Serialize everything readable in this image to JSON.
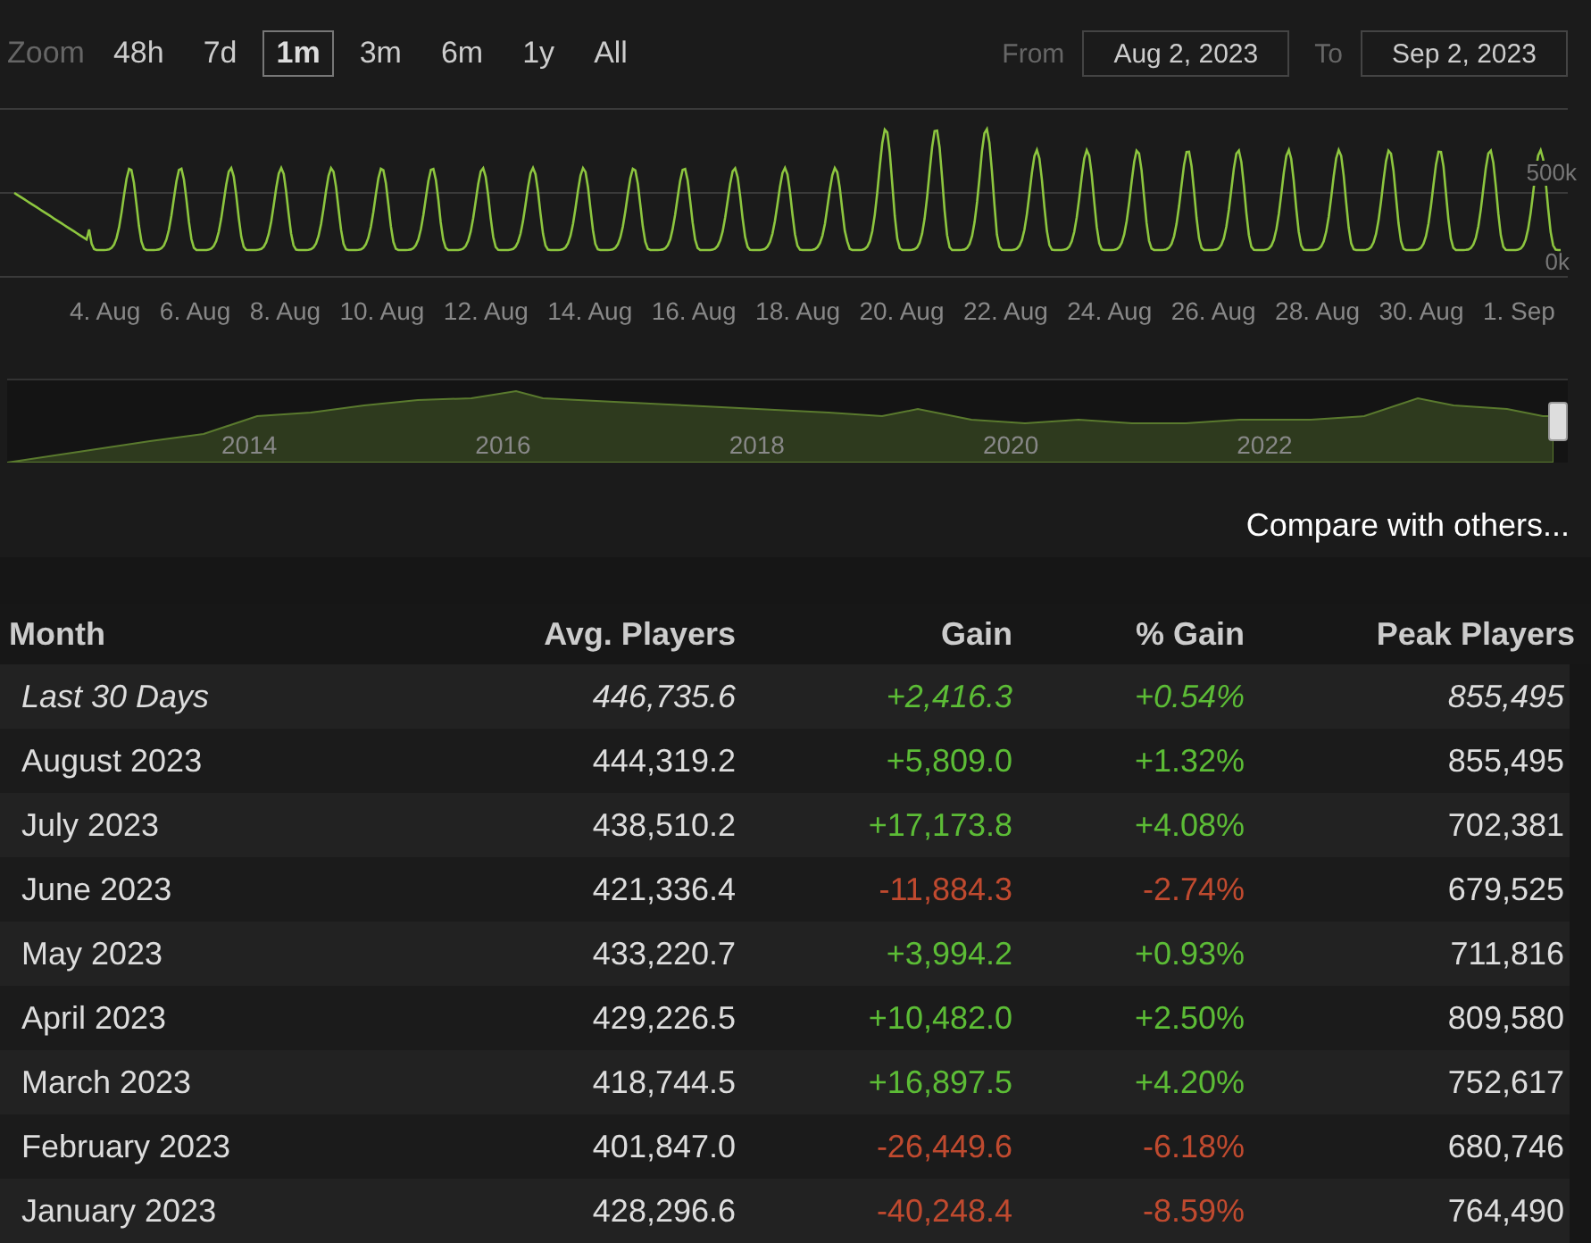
{
  "zoom": {
    "label": "Zoom",
    "options": [
      {
        "label": "48h",
        "selected": false
      },
      {
        "label": "7d",
        "selected": false
      },
      {
        "label": "1m",
        "selected": true
      },
      {
        "label": "3m",
        "selected": false
      },
      {
        "label": "6m",
        "selected": false
      },
      {
        "label": "1y",
        "selected": false
      },
      {
        "label": "All",
        "selected": false
      }
    ]
  },
  "range": {
    "from_label": "From",
    "from": "Aug 2, 2023",
    "to_label": "To",
    "to": "Sep 2, 2023"
  },
  "chart": {
    "y_labels": [
      "500k",
      "0k"
    ],
    "x_labels": [
      "4. Aug",
      "6. Aug",
      "8. Aug",
      "10. Aug",
      "12. Aug",
      "14. Aug",
      "16. Aug",
      "18. Aug",
      "20. Aug",
      "22. Aug",
      "24. Aug",
      "26. Aug",
      "28. Aug",
      "30. Aug",
      "1. Sep"
    ]
  },
  "navigator": {
    "x_labels": [
      "2014",
      "2016",
      "2018",
      "2020",
      "2022"
    ]
  },
  "compare_link": "Compare with others...",
  "table": {
    "columns": [
      "Month",
      "Avg. Players",
      "Gain",
      "% Gain",
      "Peak Players"
    ],
    "rows": [
      {
        "kind": "summary",
        "color": "#5cbc36",
        "month": "Last 30 Days",
        "avg": "446,735.6",
        "gain": "+2,416.3",
        "pct": "+0.54%",
        "peak": "855,495"
      },
      {
        "kind": "month",
        "color": "#5cbc36",
        "month": "August 2023",
        "avg": "444,319.2",
        "gain": "+5,809.0",
        "pct": "+1.32%",
        "peak": "855,495"
      },
      {
        "kind": "month",
        "color": "#5cbc36",
        "month": "July 2023",
        "avg": "438,510.2",
        "gain": "+17,173.8",
        "pct": "+4.08%",
        "peak": "702,381"
      },
      {
        "kind": "month",
        "color": "#c04a2f",
        "month": "June 2023",
        "avg": "421,336.4",
        "gain": "-11,884.3",
        "pct": "-2.74%",
        "peak": "679,525"
      },
      {
        "kind": "month",
        "color": "#5cbc36",
        "month": "May 2023",
        "avg": "433,220.7",
        "gain": "+3,994.2",
        "pct": "+0.93%",
        "peak": "711,816"
      },
      {
        "kind": "month",
        "color": "#5cbc36",
        "month": "April 2023",
        "avg": "429,226.5",
        "gain": "+10,482.0",
        "pct": "+2.50%",
        "peak": "809,580"
      },
      {
        "kind": "month",
        "color": "#5cbc36",
        "month": "March 2023",
        "avg": "418,744.5",
        "gain": "+16,897.5",
        "pct": "+4.20%",
        "peak": "752,617"
      },
      {
        "kind": "month",
        "color": "#c04a2f",
        "month": "February 2023",
        "avg": "401,847.0",
        "gain": "-26,449.6",
        "pct": "-6.18%",
        "peak": "680,746"
      },
      {
        "kind": "month",
        "color": "#c04a2f",
        "month": "January 2023",
        "avg": "428,296.6",
        "gain": "-40,248.4",
        "pct": "-8.59%",
        "peak": "764,490"
      }
    ]
  }
}
